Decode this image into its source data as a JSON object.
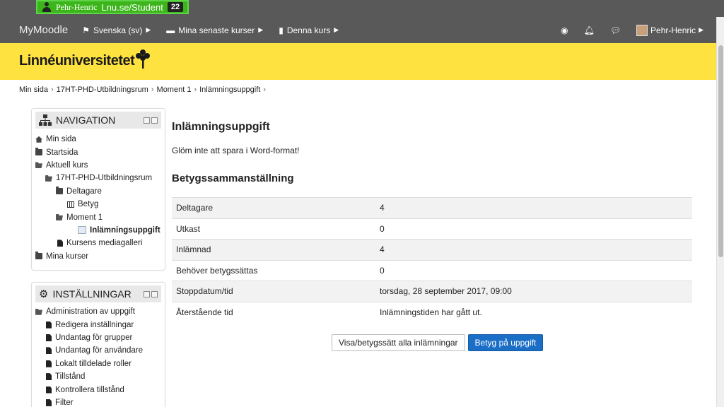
{
  "user_pill": {
    "name": "Pehr-Henric",
    "context": "Lnu.se/Student",
    "count": "22"
  },
  "navbar": {
    "brand": "MyMoodle",
    "language": "Svenska (sv)",
    "recent_courses": "Mina senaste kurser",
    "this_course": "Denna kurs",
    "username": "Pehr-Henric"
  },
  "banner": {
    "logo_text": "Linnéuniversitetet"
  },
  "breadcrumb": [
    "Min sida",
    "17HT-PHD-Utbildningsrum",
    "Moment 1",
    "Inlämningsuppgift"
  ],
  "navigation": {
    "title": "NAVIGATION",
    "items": [
      "Min sida",
      "Startsida",
      "Aktuell kurs",
      "17HT-PHD-Utbildningsrum",
      "Deltagare",
      "Betyg",
      "Moment 1",
      "Inlämningsuppgift",
      "Kursens mediagalleri",
      "Mina kurser"
    ]
  },
  "settings": {
    "title": "INSTÄLLNINGAR",
    "items": [
      "Administration av uppgift",
      "Redigera inställningar",
      "Undantag för grupper",
      "Undantag för användare",
      "Lokalt tilldelade roller",
      "Tillstånd",
      "Kontrollera tillstånd",
      "Filter"
    ]
  },
  "main": {
    "title": "Inlämningsuppgift",
    "description": "Glöm inte att spara i Word-format!",
    "summary_title": "Betygssammanställning",
    "rows": [
      {
        "label": "Deltagare",
        "value": "4"
      },
      {
        "label": "Utkast",
        "value": "0"
      },
      {
        "label": "Inlämnad",
        "value": "4"
      },
      {
        "label": "Behöver betygssättas",
        "value": "0"
      },
      {
        "label": "Stoppdatum/tid",
        "value": "torsdag, 28 september 2017, 09:00"
      },
      {
        "label": "Återstående tid",
        "value": "Inlämningstiden har gått ut."
      }
    ],
    "btn_view_all": "Visa/betygssätt alla inlämningar",
    "btn_grade": "Betyg på uppgift"
  },
  "colors": {
    "banner": "#fee340",
    "navbar": "#595959",
    "primary_button": "#1a6ec6",
    "user_pill": "#3cb51b"
  }
}
